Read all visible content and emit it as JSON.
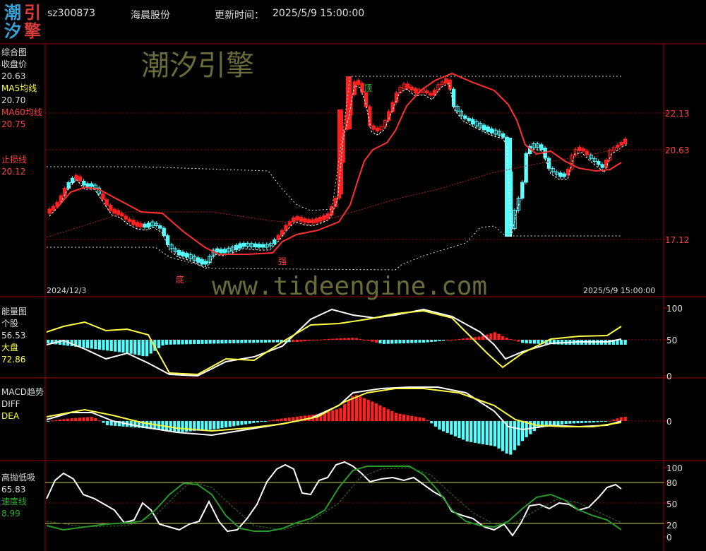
{
  "header": {
    "logo_chars": [
      "潮",
      "引",
      "汐",
      "擎"
    ],
    "code": "sz300873",
    "name": "海晨股份",
    "update_label": "更新时间：",
    "update_time": "2025/5/9 15:00:00"
  },
  "watermark": {
    "brand": "潮汐引擎",
    "url": "www.tideengine.com"
  },
  "main_panel": {
    "title": "综合图",
    "close_label": "收盘价",
    "close_value": "20.63",
    "ma5_label": "MA5均线",
    "ma5_value": "20.70",
    "ma60_label": "MA60均线",
    "ma60_value": "20.75",
    "stop_label": "止损线",
    "stop_value": "20.12",
    "price_ticks": [
      "22.13",
      "20.63",
      "17.12"
    ],
    "date_start": "2024/12/3",
    "date_end": "2025/5/9 15:00:00",
    "markers": {
      "top": "顶",
      "bottom": "底",
      "strong": "强"
    }
  },
  "energy_panel": {
    "title": "能量图",
    "stock_label": "个股",
    "stock_value": "56.53",
    "market_label": "大盘",
    "market_value": "72.86",
    "ticks": [
      "100",
      "50",
      "0"
    ]
  },
  "macd_panel": {
    "title": "MACD趋势",
    "diff_label": "DIFF",
    "dea_label": "DEA",
    "ticks": [
      "0"
    ]
  },
  "gaopao_panel": {
    "title": "高抛低吸",
    "value": "65.83",
    "speed_label": "速度线",
    "speed_value": "8.99",
    "ticks": [
      "100",
      "80",
      "50",
      "20",
      "0"
    ]
  },
  "colors": {
    "up": "#ff2020",
    "down": "#54ffff",
    "ma5": "#ffffff",
    "ma60": "#ff3030",
    "stop": "#ff3030",
    "yellow": "#ffff44",
    "green": "#2a9a2a",
    "axis": "#a00000",
    "watermark": "#6a6a3a"
  },
  "chart_data": {
    "type": "candlestick",
    "price_axis_ticks": [
      22.13,
      20.63,
      17.12
    ],
    "x_range": [
      "2024/12/3",
      "2025/5/9"
    ],
    "last_values": {
      "close": 20.63,
      "ma5": 20.7,
      "ma60": 20.75,
      "stop_loss": 20.12,
      "energy_stock": 56.53,
      "energy_market": 72.86,
      "gaopao": 65.83,
      "speed": 8.99
    },
    "energy_ylim": [
      0,
      100
    ],
    "gaopao_ylim": [
      0,
      100
    ]
  }
}
